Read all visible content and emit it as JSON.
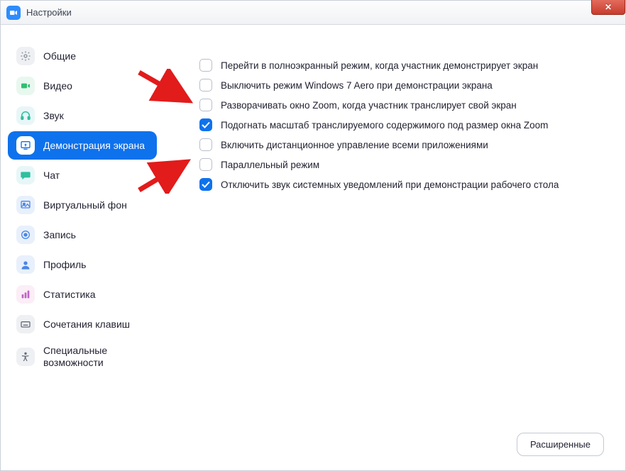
{
  "window": {
    "title": "Настройки"
  },
  "sidebar": {
    "items": [
      {
        "label": "Общие"
      },
      {
        "label": "Видео"
      },
      {
        "label": "Звук"
      },
      {
        "label": "Демонстрация экрана"
      },
      {
        "label": "Чат"
      },
      {
        "label": "Виртуальный фон"
      },
      {
        "label": "Запись"
      },
      {
        "label": "Профиль"
      },
      {
        "label": "Статистика"
      },
      {
        "label": "Сочетания клавиш"
      },
      {
        "label": "Специальные возможности"
      }
    ]
  },
  "settings": {
    "options": [
      {
        "label": "Перейти в полноэкранный режим, когда участник демонстрирует экран",
        "checked": false
      },
      {
        "label": "Выключить режим Windows 7 Aero при демонстрации экрана",
        "checked": false
      },
      {
        "label": "Разворачивать окно Zoom, когда участник транслирует свой экран",
        "checked": false
      },
      {
        "label": "Подогнать масштаб транслируемого содержимого под размер окна Zoom",
        "checked": true
      },
      {
        "label": "Включить дистанционное управление всеми приложениями",
        "checked": false
      },
      {
        "label": "Параллельный режим",
        "checked": false
      },
      {
        "label": "Отключить звук системных уведомлений при демонстрации рабочего стола",
        "checked": true
      }
    ]
  },
  "footer": {
    "advanced_label": "Расширенные"
  }
}
